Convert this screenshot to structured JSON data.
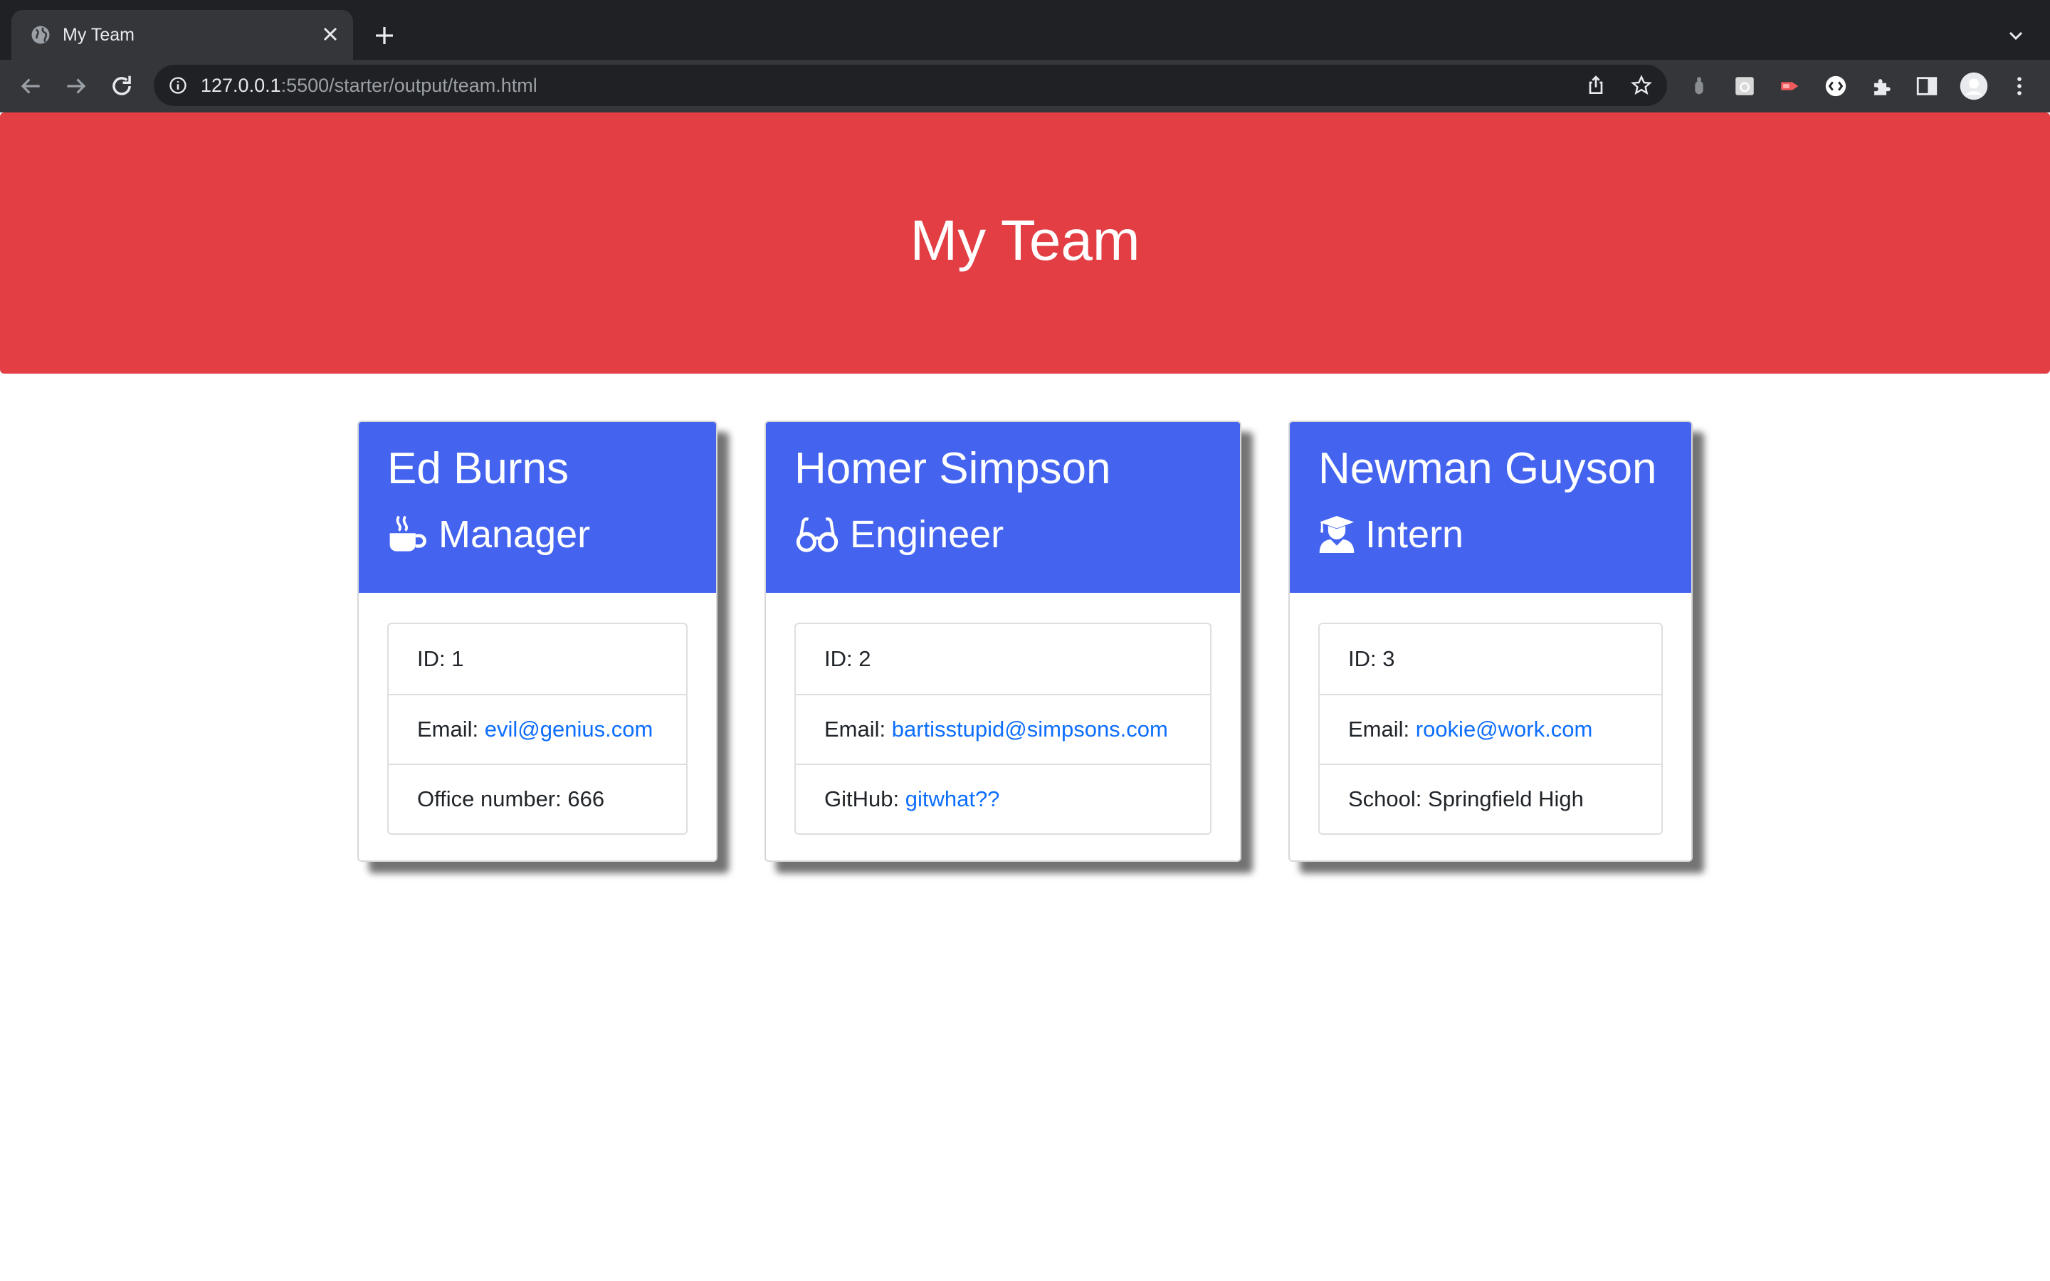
{
  "browser": {
    "tab_title": "My Team",
    "url_host": "127.0.0.1",
    "url_rest": ":5500/starter/output/team.html"
  },
  "colors": {
    "header_bg": "#e23e43",
    "card_header_bg": "#4464f0",
    "link": "#0d6efd"
  },
  "page": {
    "title": "My Team"
  },
  "team": [
    {
      "name": "Ed Burns",
      "role": "Manager",
      "icon": "mug-hot-icon",
      "id_label": "ID: 1",
      "email_label": "Email: ",
      "email": "evil@genius.com",
      "extra_label": "Office number: 666"
    },
    {
      "name": "Homer Simpson",
      "role": "Engineer",
      "icon": "glasses-icon",
      "id_label": "ID: 2",
      "email_label": "Email: ",
      "email": "bartisstupid@simpsons.com",
      "extra_label": "GitHub: ",
      "extra_link": "gitwhat??"
    },
    {
      "name": "Newman Guyson",
      "role": "Intern",
      "icon": "user-graduate-icon",
      "id_label": "ID: 3",
      "email_label": "Email: ",
      "email": "rookie@work.com",
      "extra_label": "School: Springfield High"
    }
  ]
}
